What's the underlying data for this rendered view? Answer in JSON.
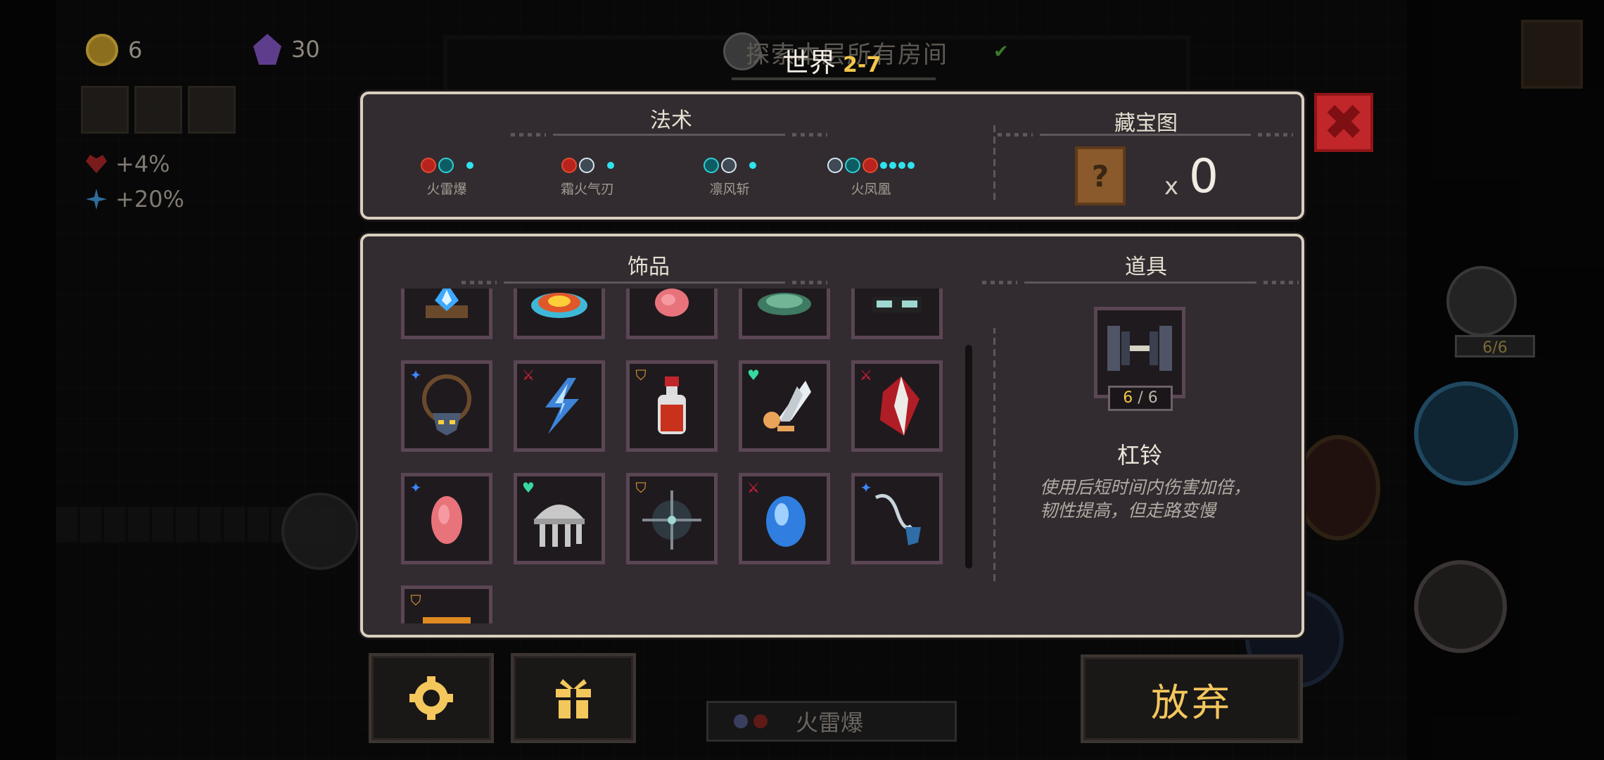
{
  "hud": {
    "coins": "6",
    "gems": "30",
    "hp_bonus": "+4%",
    "energy_bonus": "+20%"
  },
  "banner": {
    "faded_text": "探索本层所有房间",
    "world_label": "世界",
    "world_number": "2-7"
  },
  "spells_panel": {
    "title": "法术",
    "spells": [
      {
        "name": "火雷爆",
        "orbs": [
          "fire",
          "light"
        ],
        "dots": 1
      },
      {
        "name": "霜火气刃",
        "orbs": [
          "fire",
          "ice"
        ],
        "dots": 1
      },
      {
        "name": "凛风斩",
        "orbs": [
          "light",
          "ice"
        ],
        "dots": 1
      },
      {
        "name": "火凤凰",
        "orbs": [
          "ice",
          "light",
          "fire"
        ],
        "dots": 4
      }
    ]
  },
  "treasure_panel": {
    "title": "藏宝图",
    "x_label": "x",
    "count": "0"
  },
  "accessories_panel": {
    "title": "饰品",
    "rows": [
      [
        {
          "icon": "blue-crystal-hat-icon",
          "tag": null
        },
        {
          "icon": "fire-orb-shield-icon",
          "tag": null
        },
        {
          "icon": "raw-meat-icon",
          "tag": null
        },
        {
          "icon": "green-cushion-icon",
          "tag": null
        },
        {
          "icon": "dark-goggles-icon",
          "tag": null
        }
      ],
      [
        {
          "icon": "wolf-pendant-necklace-icon",
          "tag": "blue"
        },
        {
          "icon": "ice-lightning-bolt-icon",
          "tag": "red"
        },
        {
          "icon": "red-potion-bottle-icon",
          "tag": "shield"
        },
        {
          "icon": "feather-wing-icon",
          "tag": "heart"
        },
        {
          "icon": "red-crystal-icon",
          "tag": "red"
        }
      ],
      [
        {
          "icon": "raw-meat-icon",
          "tag": "blue"
        },
        {
          "icon": "iron-helmet-icon",
          "tag": "heart"
        },
        {
          "icon": "dark-spiky-orb-icon",
          "tag": "shield"
        },
        {
          "icon": "blue-gem-icon",
          "tag": "red"
        },
        {
          "icon": "blue-chain-pendant-icon",
          "tag": "blue"
        }
      ],
      [
        {
          "icon": "treasure-chest-icon",
          "tag": "shield"
        }
      ]
    ]
  },
  "props_panel": {
    "title": "道具",
    "item_name": "杠铃",
    "count_current": "6",
    "count_total": "6",
    "description": "使用后短时间内伤害加倍，韧性提高，但走路变慢"
  },
  "side_hud": {
    "barbell_count": "6/6"
  },
  "bottom": {
    "abandon_label": "放弃",
    "current_spell": "火雷爆"
  },
  "colors": {
    "panel_bg": "#322c30",
    "panel_border": "#d9cfbe",
    "accent_gold": "#f2c64a",
    "close_red": "#c0262a"
  }
}
